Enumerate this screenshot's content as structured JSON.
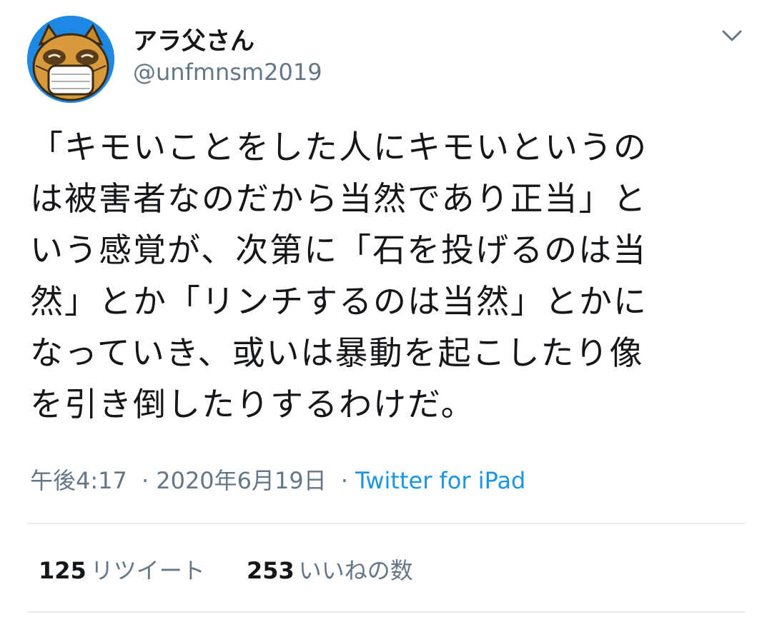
{
  "author": {
    "display_name": "アラ父さん",
    "handle": "@unfmnsm2019",
    "avatar_icon": "tanuki-mask-avatar"
  },
  "menu_icon": "chevron-down-icon",
  "tweet": {
    "lines": [
      "「キモいことをした人にキモいというの",
      "は被害者なのだから当然であり正当」と",
      "いう感覚が、次第に「石を投げるのは当",
      "然」とか「リンチするのは当然」とかに",
      "なっていき、或いは暴動を起こしたり像",
      "を引き倒したりするわけだ。"
    ]
  },
  "meta": {
    "timestamp": "午後4:17",
    "separator": "·",
    "date": "2020年6月19日",
    "source": "Twitter for iPad"
  },
  "stats": {
    "retweets": {
      "count": "125",
      "label": "リツイート"
    },
    "likes": {
      "count": "253",
      "label": "いいねの数"
    }
  },
  "colors": {
    "text": "#14171a",
    "secondary": "#657786",
    "link": "#1b95e0",
    "avatar_bg": "#1e88e5"
  }
}
